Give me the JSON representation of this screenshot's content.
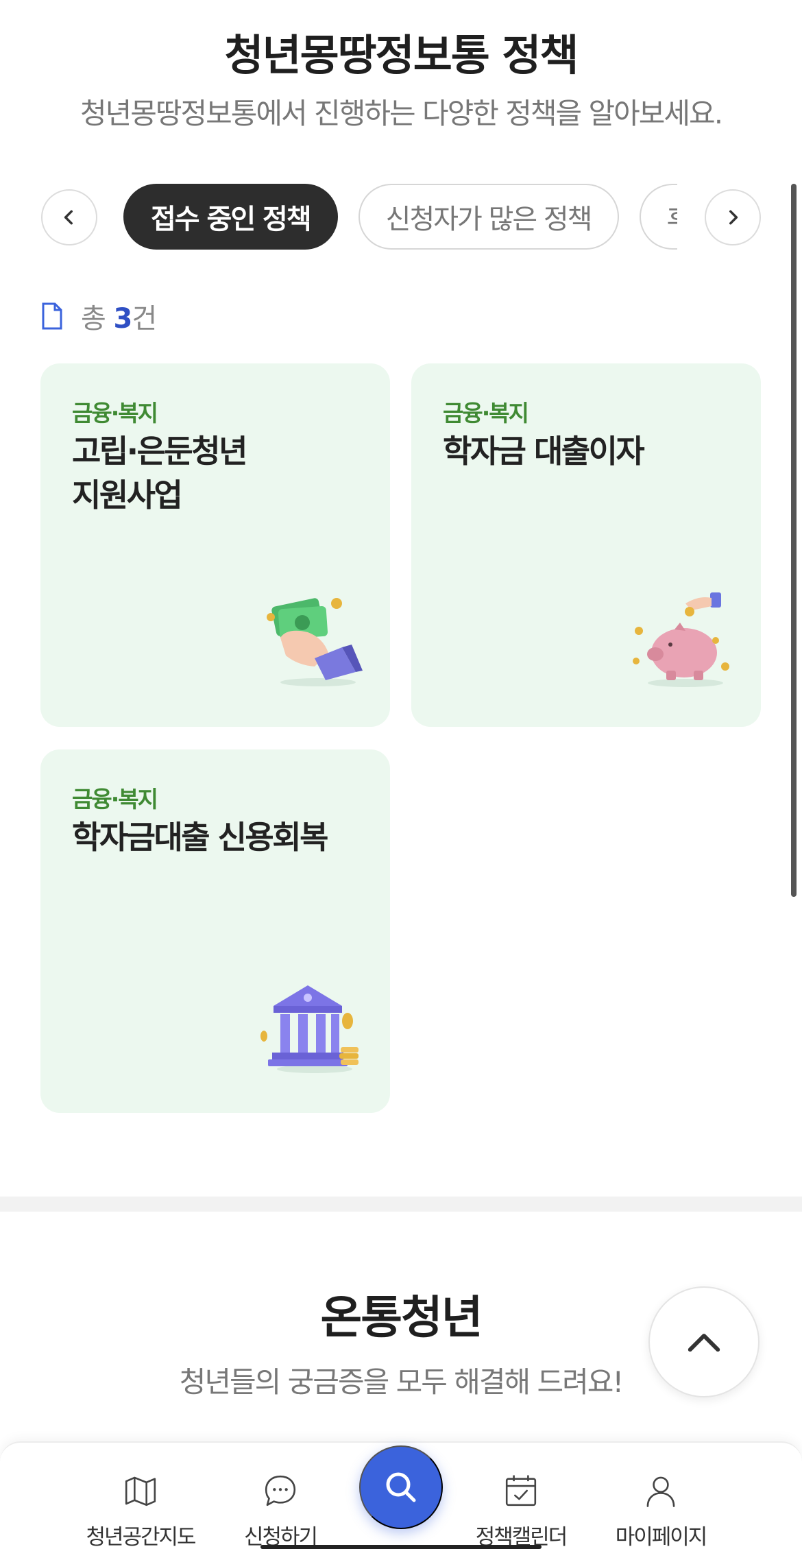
{
  "policy_section": {
    "title": "청년몽땅정보통 정책",
    "subtitle": "청년몽땅정보통에서 진행하는 다양한 정책을 알아보세요."
  },
  "tabs": [
    {
      "label": "접수 중인 정책",
      "active": true
    },
    {
      "label": "신청자가 많은 정책",
      "active": false
    },
    {
      "label": "후기",
      "active": false
    }
  ],
  "count": {
    "prefix": "총",
    "value": "3",
    "suffix": "건"
  },
  "cards": [
    {
      "category": "금융·복지",
      "title": "고립·은둔청년\n지원사업",
      "icon": "money-hand-icon"
    },
    {
      "category": "금융·복지",
      "title": "학자금 대출이자",
      "icon": "piggy-bank-icon"
    },
    {
      "category": "금융·복지",
      "title": "학자금대출 신용회복",
      "icon": "bank-building-icon"
    }
  ],
  "ontong_section": {
    "title": "온통청년",
    "subtitle": "청년들의 궁금증을 모두 해결해 드려요!"
  },
  "bottom_nav": {
    "items": [
      {
        "label": "청년공간지도",
        "icon": "map-icon"
      },
      {
        "label": "신청하기",
        "icon": "chat-icon"
      },
      {
        "label": "정책캘린더",
        "icon": "calendar-icon"
      },
      {
        "label": "마이페이지",
        "icon": "user-icon"
      }
    ],
    "center_icon": "search-icon"
  },
  "colors": {
    "accent_blue": "#3b63dc",
    "count_blue": "#2f4fc4",
    "category_green": "#3f8a33",
    "card_bg": "#ecf8ef",
    "active_tab": "#2d2d2d"
  }
}
